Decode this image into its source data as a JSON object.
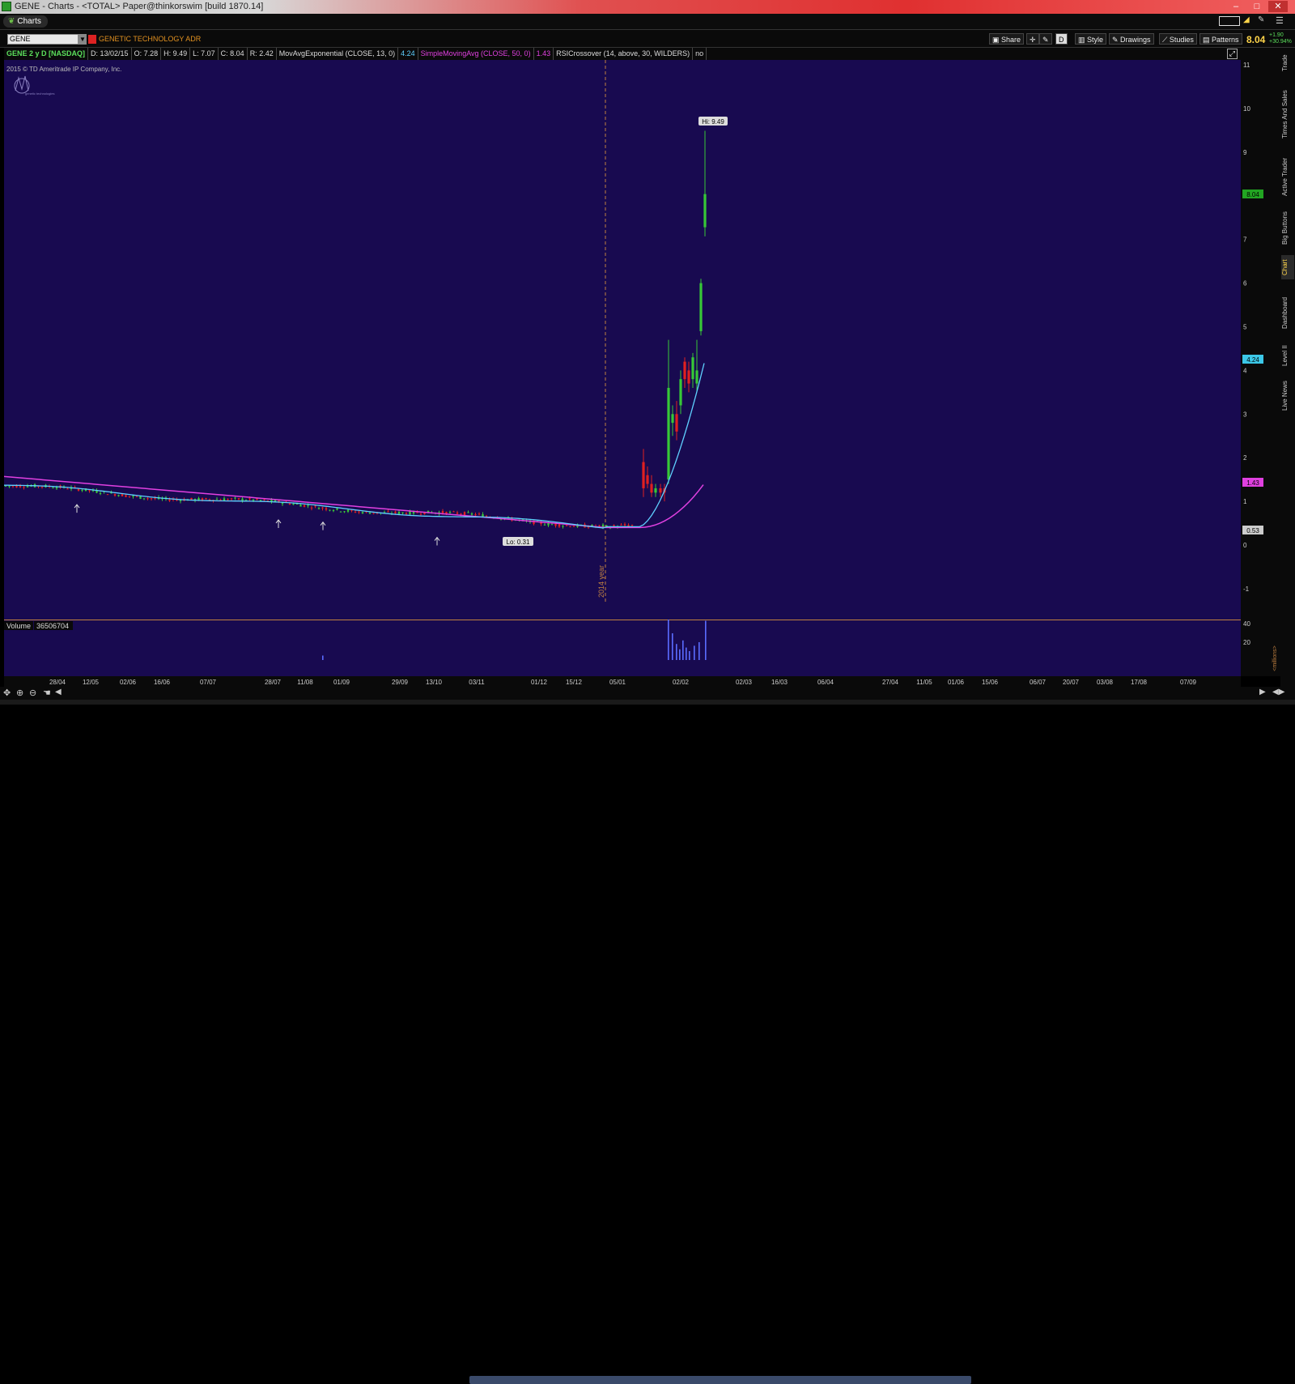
{
  "window": {
    "title": "GENE - Charts - <TOTAL> Paper@thinkorswim [build 1870.14]",
    "controls": [
      "–",
      "□",
      "✕"
    ]
  },
  "tabs": {
    "charts": "Charts"
  },
  "toolbar": {
    "symbol": "GENE",
    "company": "GENETIC TECHNOLOGY ADR",
    "share": "Share",
    "period": "D",
    "style": "Style",
    "drawings": "Drawings",
    "studies": "Studies",
    "patterns": "Patterns",
    "last_price": "8.04",
    "change": "+1.90",
    "change_pct": "+30.94%"
  },
  "infobar": {
    "label": "GENE 2 y D [NASDAQ]",
    "date": "D: 13/02/15",
    "open": "O: 7.28",
    "high": "H: 9.49",
    "low": "L: 7.07",
    "close": "C: 8.04",
    "range": "R: 2.42",
    "ema": "MovAvgExponential (CLOSE, 13, 0)",
    "ema_val": "4.24",
    "sma": "SimpleMovingAvg (CLOSE, 50, 0)",
    "sma_val": "1.43",
    "rsi": "RSICrossover (14, above, 30, WILDERS)",
    "rsi_val": "no"
  },
  "chart": {
    "copyright": "2015 © TD Ameritrade IP Company, Inc.",
    "logo_text": "genetic technologies",
    "hi_label": "Hi: 9.49",
    "lo_label": "Lo: 0.31",
    "year_marker": "2014 year",
    "price_ticks": [
      "11",
      "10",
      "9",
      "8",
      "7",
      "6",
      "5",
      "4",
      "3",
      "2",
      "1",
      "0",
      "-1"
    ],
    "price_badges": {
      "last": "8.04",
      "ema": "4.24",
      "sma": "1.43",
      "low": "0.53"
    },
    "volume_label": "Volume",
    "volume_value": "36506704",
    "volume_ticks": [
      "40",
      "20"
    ],
    "volume_unit": "<millions>",
    "x_ticks": [
      "28/04",
      "12/05",
      "02/06",
      "16/06",
      "07/07",
      "28/07",
      "11/08",
      "01/09",
      "29/09",
      "13/10",
      "03/11",
      "01/12",
      "15/12",
      "05/01",
      "02/02",
      "02/03",
      "16/03",
      "06/04",
      "27/04",
      "11/05",
      "01/06",
      "15/06",
      "06/07",
      "20/07",
      "03/08",
      "17/08",
      "07/09"
    ]
  },
  "side_tabs": [
    "Trade",
    "Times And Sales",
    "Active Trader",
    "Big Buttons",
    "Chart",
    "Dashboard",
    "Level II",
    "Live News"
  ],
  "colors": {
    "background": "#180a50",
    "up": "#37c837",
    "down": "#e02020",
    "ema": "#5fd0ff",
    "sma": "#e040e0",
    "volume": "#5a6cff"
  }
}
